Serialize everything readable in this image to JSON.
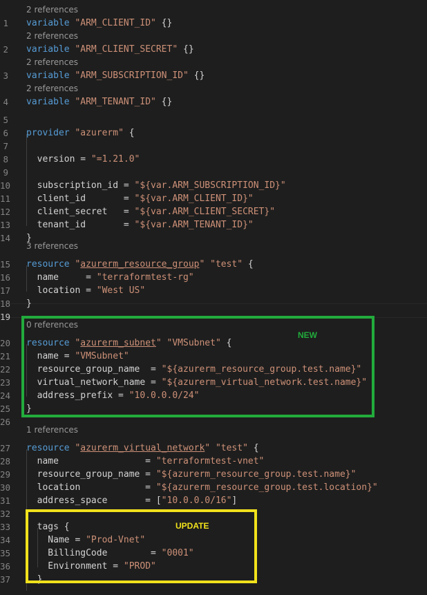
{
  "theme": {
    "keyword": "#569cd6",
    "string": "#ce9178",
    "text": "#d4d4d4",
    "lens": "#999999",
    "green_box": "#22ab3c",
    "yellow_box": "#f1e21c"
  },
  "annotations": {
    "new_label": "NEW",
    "update_label": "UPDATE"
  },
  "lenses": {
    "l1": "2 references",
    "l2": "2 references",
    "l3": "2 references",
    "l4": "2 references",
    "l15": "3 references",
    "l20": "0 references",
    "l27": "1 references"
  },
  "lines": [
    {
      "n": "1",
      "t": "variable \"ARM_CLIENT_ID\" {}"
    },
    {
      "n": "2",
      "t": "variable \"ARM_CLIENT_SECRET\" {}"
    },
    {
      "n": "3",
      "t": "variable \"ARM_SUBSCRIPTION_ID\" {}"
    },
    {
      "n": "4",
      "t": "variable \"ARM_TENANT_ID\" {}"
    },
    {
      "n": "5",
      "t": ""
    },
    {
      "n": "6",
      "t": "provider \"azurerm\" {"
    },
    {
      "n": "7",
      "t": ""
    },
    {
      "n": "8",
      "t": "  version = \"=1.21.0\""
    },
    {
      "n": "9",
      "t": ""
    },
    {
      "n": "10",
      "t": "  subscription_id = \"${var.ARM_SUBSCRIPTION_ID}\""
    },
    {
      "n": "11",
      "t": "  client_id       = \"${var.ARM_CLIENT_ID}\""
    },
    {
      "n": "12",
      "t": "  client_secret   = \"${var.ARM_CLIENT_SECRET}\""
    },
    {
      "n": "13",
      "t": "  tenant_id       = \"${var.ARM_TENANT_ID}\""
    },
    {
      "n": "14",
      "t": "}"
    },
    {
      "n": "15",
      "t": "resource \"azurerm_resource_group\" \"test\" {"
    },
    {
      "n": "16",
      "t": "  name     = \"terraformtest-rg\""
    },
    {
      "n": "17",
      "t": "  location = \"West US\""
    },
    {
      "n": "18",
      "t": "}"
    },
    {
      "n": "19",
      "t": ""
    },
    {
      "n": "20",
      "t": "resource \"azurerm_subnet\" \"VMSubnet\" {"
    },
    {
      "n": "21",
      "t": "  name = \"VMSubnet\""
    },
    {
      "n": "22",
      "t": "  resource_group_name  = \"${azurerm_resource_group.test.name}\""
    },
    {
      "n": "23",
      "t": "  virtual_network_name = \"${azurerm_virtual_network.test.name}\""
    },
    {
      "n": "24",
      "t": "  address_prefix = \"10.0.0.0/24\""
    },
    {
      "n": "25",
      "t": "}"
    },
    {
      "n": "26",
      "t": ""
    },
    {
      "n": "27",
      "t": "resource \"azurerm_virtual_network\" \"test\" {"
    },
    {
      "n": "28",
      "t": "  name                = \"terraformtest-vnet\""
    },
    {
      "n": "29",
      "t": "  resource_group_name = \"${azurerm_resource_group.test.name}\""
    },
    {
      "n": "30",
      "t": "  location            = \"${azurerm_resource_group.test.location}\""
    },
    {
      "n": "31",
      "t": "  address_space       = [\"10.0.0.0/16\"]"
    },
    {
      "n": "32",
      "t": ""
    },
    {
      "n": "33",
      "t": "  tags {"
    },
    {
      "n": "34",
      "t": "    Name = \"Prod-Vnet\""
    },
    {
      "n": "35",
      "t": "    BillingCode        = \"0001\""
    },
    {
      "n": "36",
      "t": "    Environment = \"PROD\""
    },
    {
      "n": "37",
      "t": "  }"
    }
  ]
}
